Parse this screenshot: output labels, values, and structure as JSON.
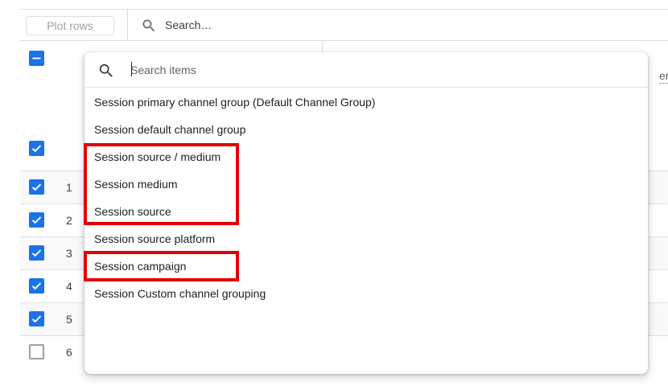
{
  "toolbar": {
    "plot_rows_label": "Plot rows",
    "search_label": "Search…"
  },
  "header_peek_text": "er",
  "rows": [
    {
      "number": "1",
      "checked": true
    },
    {
      "number": "2",
      "checked": true
    },
    {
      "number": "3",
      "checked": true
    },
    {
      "number": "4",
      "checked": true
    },
    {
      "number": "5",
      "checked": true
    },
    {
      "number": "6",
      "checked": false
    }
  ],
  "dropdown": {
    "search_placeholder": "Search items",
    "items": [
      {
        "label": "Session primary channel group (Default Channel Group)",
        "highlighted": false
      },
      {
        "label": "Session default channel group",
        "highlighted": false
      },
      {
        "label": "Session source / medium",
        "highlighted": true
      },
      {
        "label": "Session medium",
        "highlighted": true
      },
      {
        "label": "Session source",
        "highlighted": true
      },
      {
        "label": "Session source platform",
        "highlighted": false
      },
      {
        "label": "Session campaign",
        "highlighted": true
      },
      {
        "label": "Session Custom channel grouping",
        "highlighted": false
      }
    ]
  },
  "colors": {
    "accent": "#1a73e8",
    "highlight_border": "#e00000",
    "divider": "#dadce0"
  }
}
